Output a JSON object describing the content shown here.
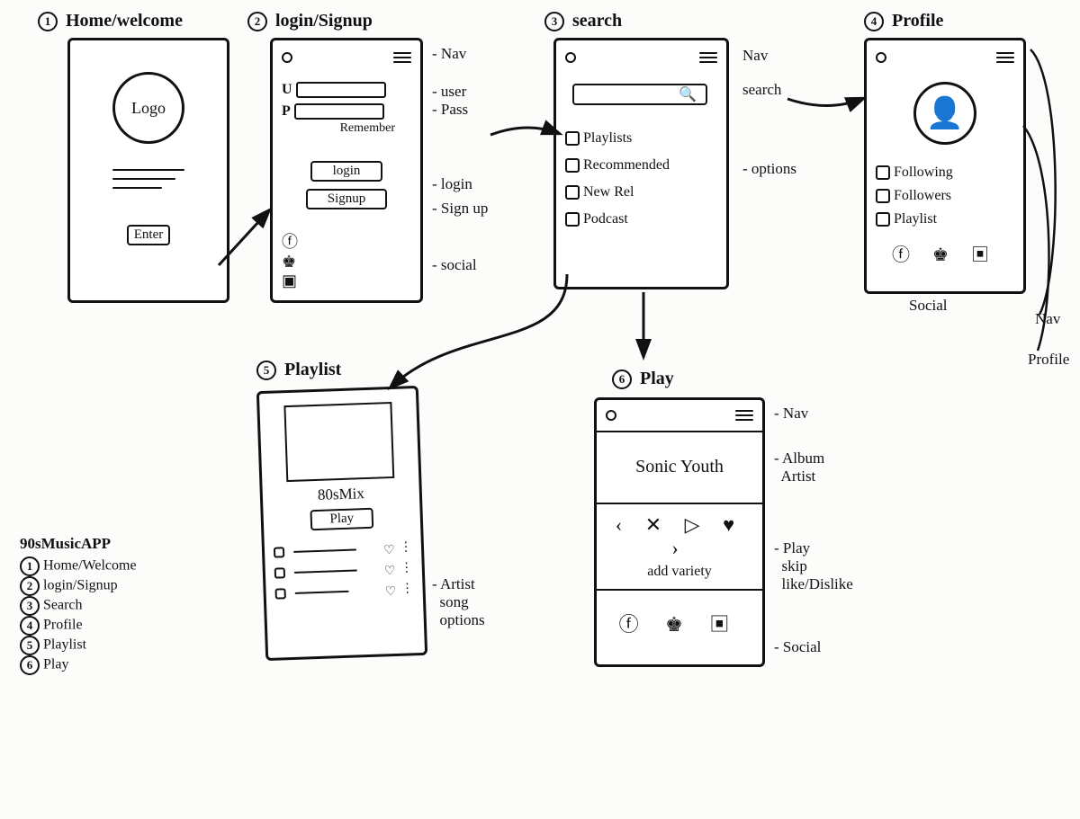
{
  "legend": {
    "title": "90sMusicAPP",
    "items": [
      {
        "n": "1",
        "label": "Home/Welcome"
      },
      {
        "n": "2",
        "label": "login/Signup"
      },
      {
        "n": "3",
        "label": "Search"
      },
      {
        "n": "4",
        "label": "Profile"
      },
      {
        "n": "5",
        "label": "Playlist"
      },
      {
        "n": "6",
        "label": "Play"
      }
    ]
  },
  "screens": {
    "home": {
      "n": "1",
      "title": "Home/welcome",
      "logo": "Logo",
      "enter": "Enter"
    },
    "login": {
      "n": "2",
      "title": "login/Signup",
      "u": "U",
      "p": "P",
      "remember": "Remember",
      "login": "login",
      "signup": "Signup",
      "ann_nav": "- Nav",
      "ann_user": "- user",
      "ann_pass": "- Pass",
      "ann_login": "- login",
      "ann_signup": "- Sign up",
      "ann_social": "- social"
    },
    "search": {
      "n": "3",
      "title": "search",
      "opts": [
        "Playlists",
        "Recommended",
        "New Rel",
        "Podcast"
      ],
      "ann_nav": "Nav",
      "ann_search": "search",
      "ann_options": "- options"
    },
    "profile": {
      "n": "4",
      "title": "Profile",
      "opts": [
        "Following",
        "Followers",
        "Playlist"
      ],
      "ann_social": "Social",
      "ann_nav": "Nav",
      "ann_profile": "Profile"
    },
    "playlist": {
      "n": "5",
      "title": "Playlist",
      "name": "80sMix",
      "play": "Play",
      "ann": "- Artist\n  song\n  options"
    },
    "play": {
      "n": "6",
      "title": "Play",
      "artist": "Sonic Youth",
      "variety": "add variety",
      "ann_nav": "- Nav",
      "ann_album": "- Album\n  Artist",
      "ann_controls": "- Play\n  skip\n  like/Dislike",
      "ann_social": "- Social"
    }
  }
}
